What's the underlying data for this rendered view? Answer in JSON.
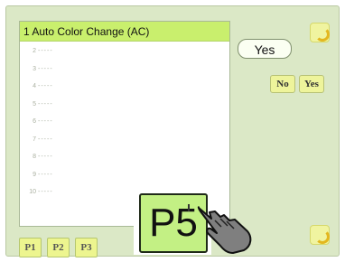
{
  "list": {
    "title": "1 Auto Color Change (AC)",
    "rows": [
      {
        "num": "2",
        "dashes": "-----"
      },
      {
        "num": "3",
        "dashes": "-----"
      },
      {
        "num": "4",
        "dashes": "-----"
      },
      {
        "num": "5",
        "dashes": "-----"
      },
      {
        "num": "6",
        "dashes": "-----"
      },
      {
        "num": "7",
        "dashes": "-----"
      },
      {
        "num": "8",
        "dashes": "-----"
      },
      {
        "num": "9",
        "dashes": "-----"
      },
      {
        "num": "10",
        "dashes": "-----"
      }
    ]
  },
  "right_panel": {
    "yes_label": "Yes",
    "no_label": "No",
    "yes_small_label": "Yes"
  },
  "tabs": [
    "P1",
    "P2",
    "P3"
  ],
  "callout": {
    "label": "P5"
  },
  "icons": {
    "top": "undo-icon",
    "bottom": "return-icon",
    "pointer": "hand-pointer-icon"
  },
  "colors": {
    "screen_bg": "#dbe8c6",
    "title_bar": "#c9ef6d",
    "button_bg": "#edf58f",
    "p5_bg": "#c3f084"
  }
}
